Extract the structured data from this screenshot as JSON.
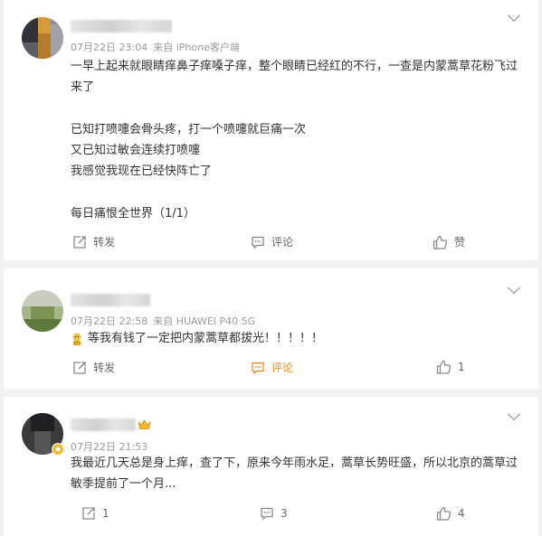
{
  "comments": [
    {
      "time": "07月22日 23:04",
      "source": "来自 iPhone客户端",
      "text_lines": [
        "一早上起来就眼睛痒鼻子痒嗓子痒，整个眼睛已经红的不行，一查是内蒙蒿草花粉飞过",
        "来了",
        "",
        "已知打喷嚏会骨头疼，打一个喷嚏就巨痛一次",
        "又已知过敏会连续打喷嚏",
        "我感觉我现在已经快阵亡了",
        "",
        "每日痛恨全世界（1/1）"
      ],
      "repost_label": "转发",
      "comment_label": "评论",
      "like_label": "赞"
    },
    {
      "time": "07月22日 22:58",
      "source": "来自 HUAWEI P40 5G",
      "text": "等我有钱了一定把内蒙蒿草都拔光！！！！！",
      "repost_label": "转发",
      "comment_label": "评论",
      "like_count": "1"
    },
    {
      "time": "07月22日 21:53",
      "text_lines": [
        "我最近几天总是身上痒，查了下，原来今年雨水足，蒿草长势旺盛，所以北京的蒿草过",
        "敏季提前了一个月..."
      ],
      "repost_count": "1",
      "comment_count": "3",
      "like_count": "4"
    }
  ],
  "colors": {
    "accent": "#f28b1a",
    "meta": "#9a9a9a",
    "text": "#333333",
    "background": "#f2f2f2"
  },
  "icons": {
    "repost": "repost-icon",
    "comment": "comment-icon",
    "like": "thumbs-up-icon",
    "more": "chevron-down-icon",
    "emoji": "emoji-icon",
    "badge": "crown-badge-icon",
    "verified": "verified-icon"
  }
}
